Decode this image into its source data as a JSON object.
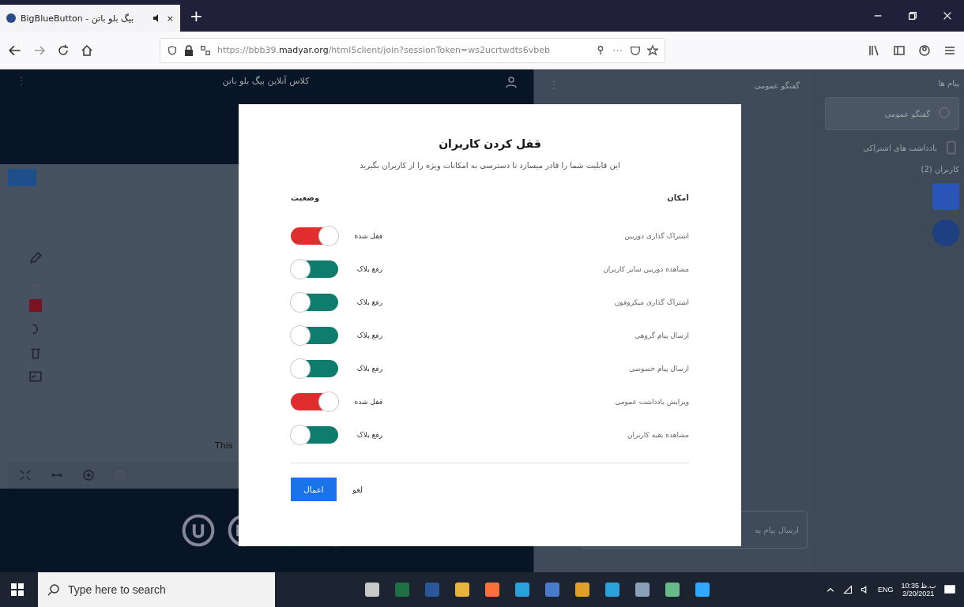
{
  "browser": {
    "tab_title": "BigBlueButton - بیگ بلو باتن",
    "tab_close": "×",
    "new_tab": "+",
    "url_host": "https://bbb39.",
    "url_domain": "madyar.org",
    "url_path": "/html5client/join?sessionToken=ws2ucrtwdts6vbeb"
  },
  "meeting": {
    "title": "کلاس آنلاین بیگ بلو باتن",
    "slide_text": "This"
  },
  "chat": {
    "title": "گفتگو عمومی",
    "input_placeholder": "ارسال پیام به"
  },
  "userlist": {
    "messages_heading": "پیام ها",
    "public_chat": "گفتگو عمومی",
    "shared_notes": "یادداشت های اشتراکی",
    "users_heading": "کاربران (2)"
  },
  "dialog": {
    "title": "قفل کردن کاربران",
    "description": "این قابلیت شما را قادر میسازد تا دسترسی به امکانات ویژه را از کاربران بگیرید",
    "feature_heading": "امکان",
    "status_heading": "وضعیت",
    "rows": [
      {
        "feature": "اشتراک گذاری دوربین",
        "status": "قفل شده",
        "locked": true
      },
      {
        "feature": "مشاهده دوربین سایر کاربران",
        "status": "رفع بلاک",
        "locked": false
      },
      {
        "feature": "اشتراک گذاری میکروفون",
        "status": "رفع بلاک",
        "locked": false
      },
      {
        "feature": "ارسال پیام گروهی",
        "status": "رفع بلاک",
        "locked": false
      },
      {
        "feature": "ارسال پیام خصوصی",
        "status": "رفع بلاک",
        "locked": false
      },
      {
        "feature": "ویرایش یادداشت عمومی",
        "status": "قفل شده",
        "locked": true
      },
      {
        "feature": "مشاهده بقیه کاربران",
        "status": "رفع بلاک",
        "locked": false
      }
    ],
    "cancel": "لغو",
    "apply": "اعمال"
  },
  "taskbar": {
    "search_placeholder": "Type here to search",
    "language": "ENG",
    "time": "10:35 ب.ظ",
    "date": "2/20/2021"
  }
}
